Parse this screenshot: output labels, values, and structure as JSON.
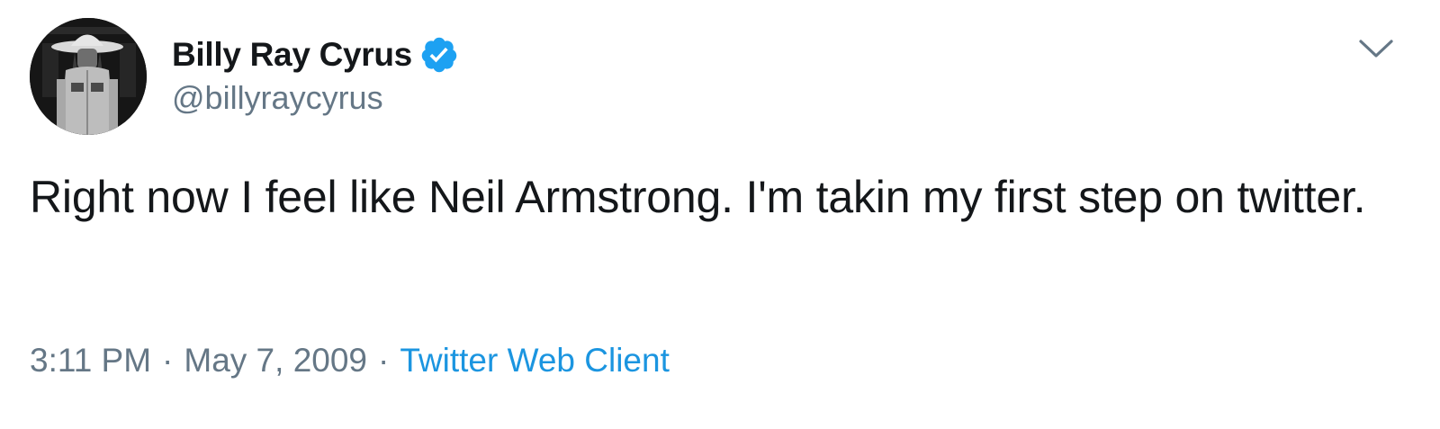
{
  "author": {
    "display_name": "Billy Ray Cyrus",
    "handle": "@billyraycyrus",
    "verified": true,
    "avatar_icon": "profile-photo"
  },
  "tweet": {
    "text": "Right now I feel like Neil Armstrong. I'm takin my first step on twitter.",
    "time": "3:11 PM",
    "separator": "·",
    "date": "May 7, 2009",
    "source": "Twitter Web Client"
  },
  "icons": {
    "verified": "verified-badge-icon",
    "menu": "chevron-down-icon"
  },
  "colors": {
    "text": "#14171a",
    "secondary": "#657786",
    "link": "#1b95e0",
    "verified": "#1da1f2"
  }
}
